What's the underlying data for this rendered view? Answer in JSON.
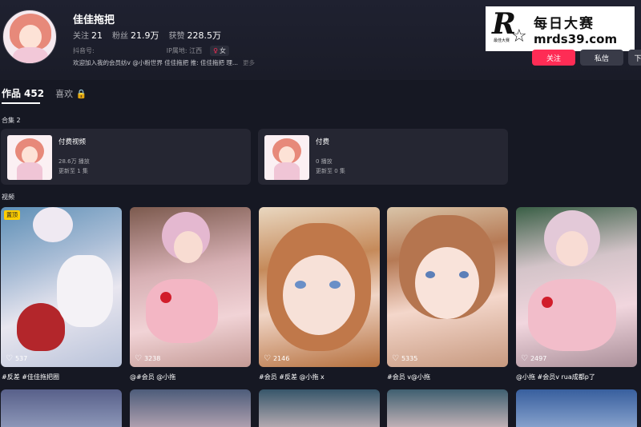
{
  "profile": {
    "name": "佳佳拖把",
    "following_label": "关注",
    "following": "21",
    "fans_label": "粉丝",
    "fans": "21.9万",
    "likes_label": "获赞",
    "likes": "228.5万",
    "douyin_id_label": "抖音号:",
    "ip_label": "IP属地:",
    "ip_value": "江西",
    "gender": "女",
    "bio": "欢迎加入我的会员纺v @小粉世界 佳佳拖把 推: 佳佳拖把 理...",
    "more": "更多"
  },
  "watermark": {
    "logo_letter": "R",
    "logo_sub": "最佳大赛",
    "title": "每日大赛",
    "url": "mrds39.com"
  },
  "actions": {
    "follow": "关注",
    "message": "私信",
    "more": "下"
  },
  "tabs": {
    "works_label": "作品",
    "works_count": "452",
    "likes_label": "喜欢"
  },
  "collections": {
    "label": "合集 2",
    "items": [
      {
        "title": "付费视频",
        "plays": "28.6万 播放",
        "updated": "更新至 1 集"
      },
      {
        "title": "付费",
        "plays": "0 播放",
        "updated": "更新至 0 集"
      }
    ]
  },
  "videos": {
    "label": "视频",
    "pinned_label": "置顶",
    "items": [
      {
        "likes": "537",
        "caption": "#反差 #佳佳拖把圈"
      },
      {
        "likes": "3238",
        "caption": "@#会员 @小拖"
      },
      {
        "likes": "2146",
        "caption": "#会员 #反差 @小拖 x"
      },
      {
        "likes": "5335",
        "caption": "#会员 v@小拖"
      },
      {
        "likes": "2497",
        "caption": "@小拖 #会员v rua成都p了"
      }
    ]
  },
  "colors": {
    "background": "#161823",
    "accent": "#fe2c55",
    "pin": "#fece00"
  }
}
